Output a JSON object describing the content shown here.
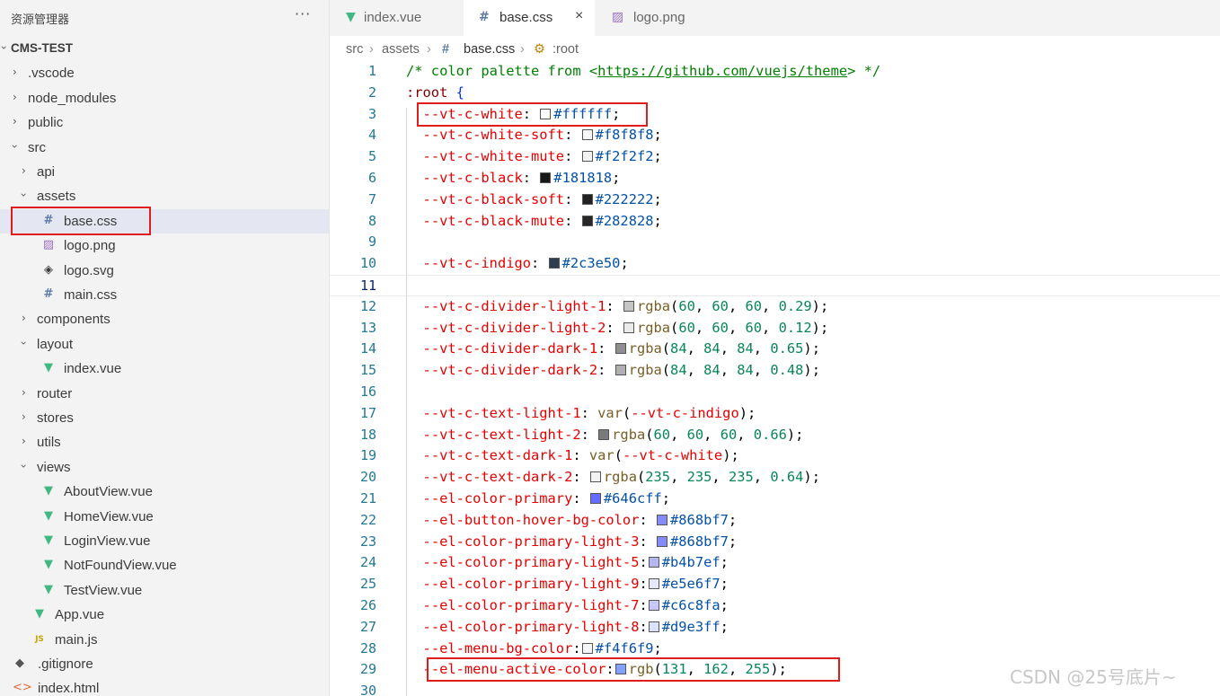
{
  "explorer": {
    "title": "资源管理器",
    "more_icon": "ellipsis-icon",
    "project": "CMS-TEST",
    "items": [
      {
        "label": "CMS-TEST",
        "depth": 0,
        "type": "folder",
        "open": true
      },
      {
        "label": ".vscode",
        "depth": 1,
        "type": "folder",
        "open": false
      },
      {
        "label": "node_modules",
        "depth": 1,
        "type": "folder",
        "open": false
      },
      {
        "label": "public",
        "depth": 1,
        "type": "folder",
        "open": false
      },
      {
        "label": "src",
        "depth": 1,
        "type": "folder",
        "open": true
      },
      {
        "label": "api",
        "depth": 2,
        "type": "folder",
        "open": false
      },
      {
        "label": "assets",
        "depth": 2,
        "type": "folder",
        "open": true
      },
      {
        "label": "base.css",
        "depth": 3,
        "type": "css",
        "selected": true
      },
      {
        "label": "logo.png",
        "depth": 3,
        "type": "img"
      },
      {
        "label": "logo.svg",
        "depth": 3,
        "type": "svg"
      },
      {
        "label": "main.css",
        "depth": 3,
        "type": "css"
      },
      {
        "label": "components",
        "depth": 2,
        "type": "folder",
        "open": false
      },
      {
        "label": "layout",
        "depth": 2,
        "type": "folder",
        "open": true
      },
      {
        "label": "index.vue",
        "depth": 3,
        "type": "vue"
      },
      {
        "label": "router",
        "depth": 2,
        "type": "folder",
        "open": false
      },
      {
        "label": "stores",
        "depth": 2,
        "type": "folder",
        "open": false
      },
      {
        "label": "utils",
        "depth": 2,
        "type": "folder",
        "open": false
      },
      {
        "label": "views",
        "depth": 2,
        "type": "folder",
        "open": true
      },
      {
        "label": "AboutView.vue",
        "depth": 3,
        "type": "vue"
      },
      {
        "label": "HomeView.vue",
        "depth": 3,
        "type": "vue"
      },
      {
        "label": "LoginView.vue",
        "depth": 3,
        "type": "vue"
      },
      {
        "label": "NotFoundView.vue",
        "depth": 3,
        "type": "vue"
      },
      {
        "label": "TestView.vue",
        "depth": 3,
        "type": "vue"
      },
      {
        "label": "App.vue",
        "depth": 2,
        "type": "vue"
      },
      {
        "label": "main.js",
        "depth": 2,
        "type": "js"
      },
      {
        "label": ".gitignore",
        "depth": 1,
        "type": "git"
      },
      {
        "label": "index.html",
        "depth": 1,
        "type": "html"
      }
    ]
  },
  "tabs": [
    {
      "label": "index.vue",
      "icon": "vue-file-icon",
      "active": false
    },
    {
      "label": "base.css",
      "icon": "css-file-icon",
      "active": true,
      "close": "×"
    },
    {
      "label": "logo.png",
      "icon": "image-file-icon",
      "active": false
    }
  ],
  "breadcrumb": {
    "parts": [
      "src",
      "assets",
      "base.css",
      ":root"
    ],
    "separator": ">"
  },
  "icons": {
    "vue": "▼",
    "css": "#",
    "js": "JS",
    "img": "▨",
    "svg": "◈",
    "git": "◆",
    "html": "<>",
    "chevron": "›",
    "selector": "⚙"
  },
  "editor": {
    "comment": {
      "prefix": "/* color palette from <",
      "url": "https://github.com/vuejs/theme",
      "suffix": "> */"
    },
    "selector": ":root",
    "open_brace": "{",
    "current_line": 11,
    "lines": [
      {
        "n": 1,
        "kind": "comment"
      },
      {
        "n": 2,
        "kind": "selector"
      },
      {
        "n": 3,
        "prop": "--vt-c-white",
        "value": "#ffffff",
        "swatch": "#ffffff"
      },
      {
        "n": 4,
        "prop": "--vt-c-white-soft",
        "value": "#f8f8f8",
        "swatch": "#f8f8f8"
      },
      {
        "n": 5,
        "prop": "--vt-c-white-mute",
        "value": "#f2f2f2",
        "swatch": "#f2f2f2"
      },
      {
        "n": 6,
        "prop": "--vt-c-black",
        "value": "#181818",
        "swatch": "#181818"
      },
      {
        "n": 7,
        "prop": "--vt-c-black-soft",
        "value": "#222222",
        "swatch": "#222222"
      },
      {
        "n": 8,
        "prop": "--vt-c-black-mute",
        "value": "#282828",
        "swatch": "#282828"
      },
      {
        "n": 9
      },
      {
        "n": 10,
        "prop": "--vt-c-indigo",
        "value": "#2c3e50",
        "swatch": "#2c3e50"
      },
      {
        "n": 11
      },
      {
        "n": 12,
        "prop": "--vt-c-divider-light-1",
        "fn": "rgba",
        "args": [
          "60",
          "60",
          "60",
          "0.29"
        ],
        "swatch": "#c5c5c5"
      },
      {
        "n": 13,
        "prop": "--vt-c-divider-light-2",
        "fn": "rgba",
        "args": [
          "60",
          "60",
          "60",
          "0.12"
        ],
        "swatch": "#eaeaea"
      },
      {
        "n": 14,
        "prop": "--vt-c-divider-dark-1",
        "fn": "rgba",
        "args": [
          "84",
          "84",
          "84",
          "0.65"
        ],
        "swatch": "#8f8f8f"
      },
      {
        "n": 15,
        "prop": "--vt-c-divider-dark-2",
        "fn": "rgba",
        "args": [
          "84",
          "84",
          "84",
          "0.48"
        ],
        "swatch": "#b0b0b0"
      },
      {
        "n": 16
      },
      {
        "n": 17,
        "prop": "--vt-c-text-light-1",
        "var": "--vt-c-indigo"
      },
      {
        "n": 18,
        "prop": "--vt-c-text-light-2",
        "fn": "rgba",
        "args": [
          "60",
          "60",
          "60",
          "0.66"
        ],
        "swatch": "#7a7a7a"
      },
      {
        "n": 19,
        "prop": "--vt-c-text-dark-1",
        "var": "--vt-c-white"
      },
      {
        "n": 20,
        "prop": "--vt-c-text-dark-2",
        "fn": "rgba",
        "args": [
          "235",
          "235",
          "235",
          "0.64"
        ],
        "swatch": "#f2f2f2"
      },
      {
        "n": 21,
        "prop": "--el-color-primary",
        "value": "#646cff",
        "swatch": "#646cff"
      },
      {
        "n": 22,
        "prop": "--el-button-hover-bg-color",
        "value": "#868bf7",
        "swatch": "#868bf7"
      },
      {
        "n": 23,
        "prop": "--el-color-primary-light-3",
        "value": "#868bf7",
        "swatch": "#868bf7"
      },
      {
        "n": 24,
        "prop": "--el-color-primary-light-5",
        "value": "#b4b7ef",
        "swatch": "#b4b7ef",
        "tight": true
      },
      {
        "n": 25,
        "prop": "--el-color-primary-light-9",
        "value": "#e5e6f7",
        "swatch": "#e5e6f7",
        "tight": true
      },
      {
        "n": 26,
        "prop": "--el-color-primary-light-7",
        "value": "#c6c8fa",
        "swatch": "#c6c8fa",
        "tight": true
      },
      {
        "n": 27,
        "prop": "--el-color-primary-light-8",
        "value": "#d9e3ff",
        "swatch": "#d9e3ff",
        "tight": true
      },
      {
        "n": 28,
        "prop": "--el-menu-bg-color",
        "value": "#f4f6f9",
        "swatch": "#f4f6f9",
        "tight": true
      },
      {
        "n": 29,
        "prop": "--el-menu-active-color",
        "fn": "rgb",
        "args": [
          "131",
          "162",
          "255"
        ],
        "swatch": "#83a2ff",
        "tight": true
      },
      {
        "n": 30
      }
    ]
  },
  "watermark": "CSDN @25号底片~",
  "highlight_color": "#e01c1c"
}
